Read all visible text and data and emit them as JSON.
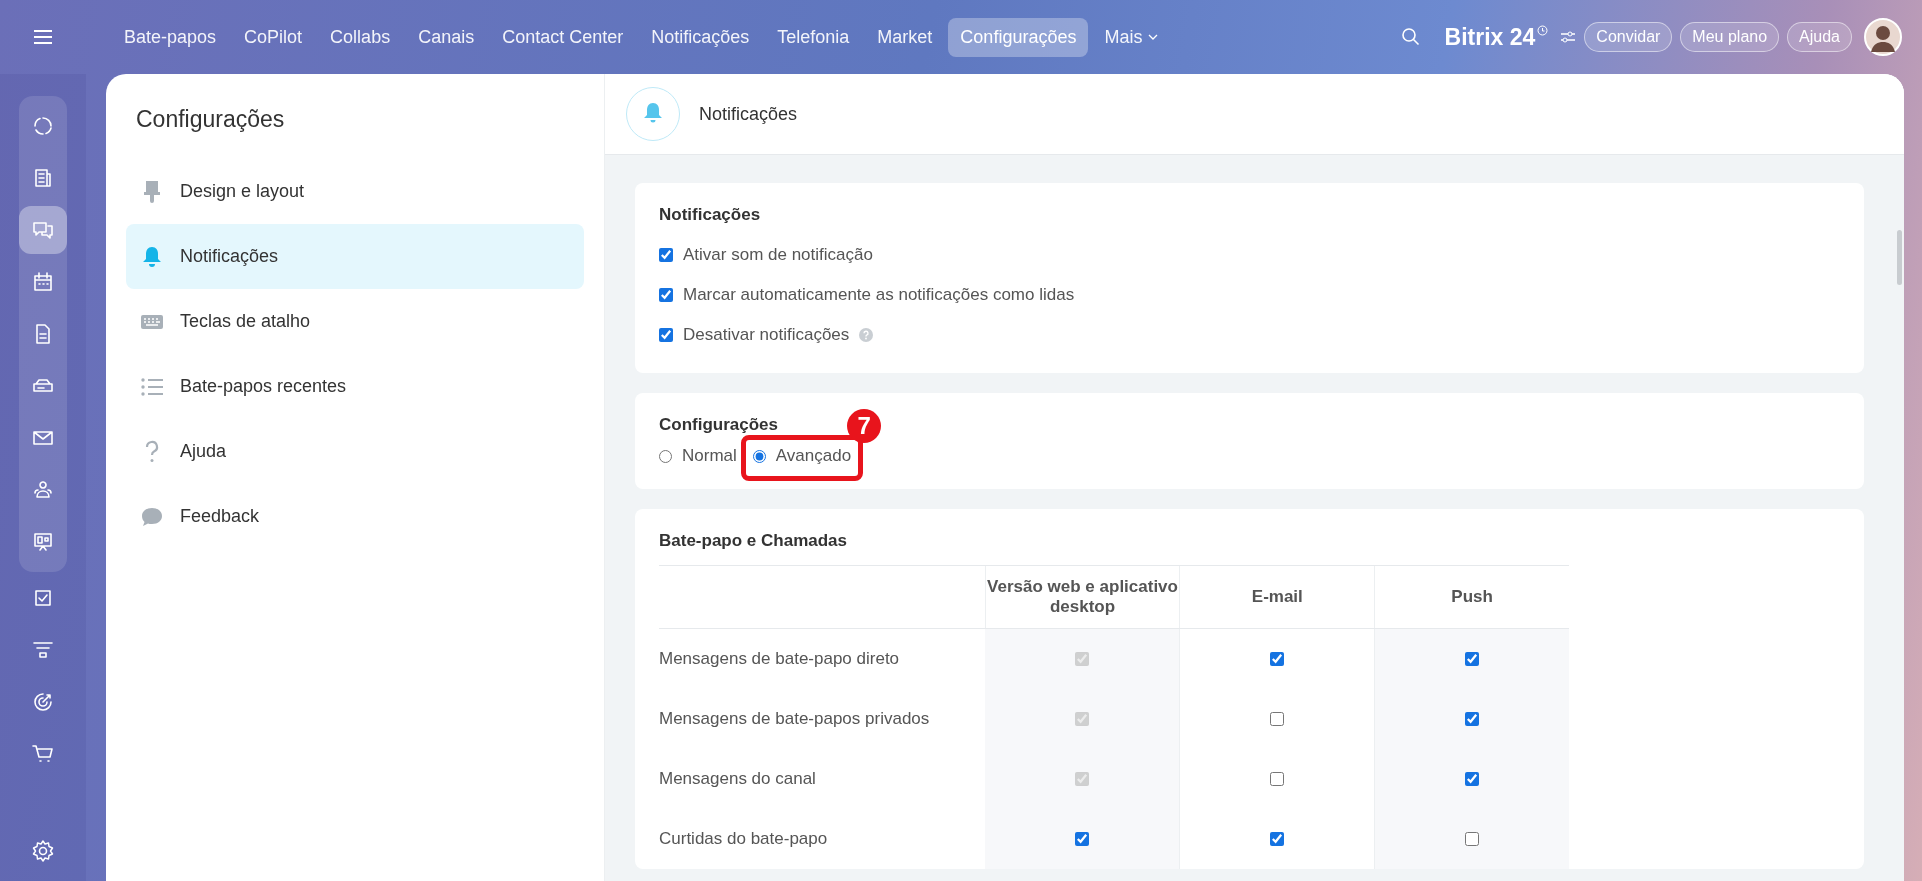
{
  "top_nav": {
    "items": [
      {
        "label": "Bate-papos",
        "selected": false
      },
      {
        "label": "CoPilot",
        "selected": false
      },
      {
        "label": "Collabs",
        "selected": false
      },
      {
        "label": "Canais",
        "selected": false
      },
      {
        "label": "Contact Center",
        "selected": false
      },
      {
        "label": "Notificações",
        "selected": false
      },
      {
        "label": "Telefonia",
        "selected": false
      },
      {
        "label": "Market",
        "selected": false
      },
      {
        "label": "Configurações",
        "selected": true
      }
    ],
    "more": "Mais",
    "logo": {
      "name": "Bitrix",
      "number": "24"
    },
    "buttons": [
      "Convidar",
      "Meu plano",
      "Ajuda"
    ]
  },
  "rail": {
    "items": [
      {
        "kind": "flow",
        "selected": false
      },
      {
        "kind": "news",
        "selected": false
      },
      {
        "kind": "chat",
        "selected": true
      },
      {
        "kind": "calendar",
        "selected": false
      },
      {
        "kind": "doc",
        "selected": false
      },
      {
        "kind": "drive",
        "selected": false
      },
      {
        "kind": "mail",
        "selected": false
      },
      {
        "kind": "people",
        "selected": false
      },
      {
        "kind": "board",
        "selected": false
      },
      {
        "kind": "task",
        "selected": false
      },
      {
        "kind": "funnel",
        "selected": false
      },
      {
        "kind": "target",
        "selected": false
      },
      {
        "kind": "cart",
        "selected": false
      }
    ]
  },
  "settings_nav": {
    "title": "Configurações",
    "items": [
      {
        "label": "Design e layout",
        "kind": "brush",
        "selected": false
      },
      {
        "label": "Notificações",
        "kind": "bell",
        "selected": true
      },
      {
        "label": "Teclas de atalho",
        "kind": "keyboard",
        "selected": false
      },
      {
        "label": "Bate-papos recentes",
        "kind": "list",
        "selected": false
      },
      {
        "label": "Ajuda",
        "kind": "question",
        "selected": false
      },
      {
        "label": "Feedback",
        "kind": "bubble",
        "selected": false
      }
    ]
  },
  "header": {
    "title": "Notificações"
  },
  "notifications_card": {
    "title": "Notificações",
    "options": [
      {
        "label": "Ativar som de notificação",
        "checked": true,
        "help": false
      },
      {
        "label": "Marcar automaticamente as notificações como lidas",
        "checked": true,
        "help": false
      },
      {
        "label": "Desativar notificações",
        "checked": true,
        "help": true
      }
    ]
  },
  "mode_card": {
    "title": "Configurações",
    "options": [
      {
        "label": "Normal",
        "selected": false,
        "annotated": false
      },
      {
        "label": "Avançado",
        "selected": true,
        "annotated": true
      }
    ],
    "annotation": "7"
  },
  "table_card": {
    "title": "Bate-papo e Chamadas",
    "columns": [
      "Versão web e aplicativo desktop",
      "E-mail",
      "Push"
    ],
    "rows": [
      {
        "label": "Mensagens de bate-papo direto",
        "cells": [
          {
            "checked": true,
            "disabled": true
          },
          {
            "checked": true,
            "disabled": false
          },
          {
            "checked": true,
            "disabled": false
          }
        ]
      },
      {
        "label": "Mensagens de bate-papos privados",
        "cells": [
          {
            "checked": true,
            "disabled": true
          },
          {
            "checked": false,
            "disabled": false
          },
          {
            "checked": true,
            "disabled": false
          }
        ]
      },
      {
        "label": "Mensagens do canal",
        "cells": [
          {
            "checked": true,
            "disabled": true
          },
          {
            "checked": false,
            "disabled": false
          },
          {
            "checked": true,
            "disabled": false
          }
        ]
      },
      {
        "label": "Curtidas do bate-papo",
        "cells": [
          {
            "checked": true,
            "disabled": false
          },
          {
            "checked": true,
            "disabled": false
          },
          {
            "checked": false,
            "disabled": false
          }
        ]
      }
    ]
  }
}
